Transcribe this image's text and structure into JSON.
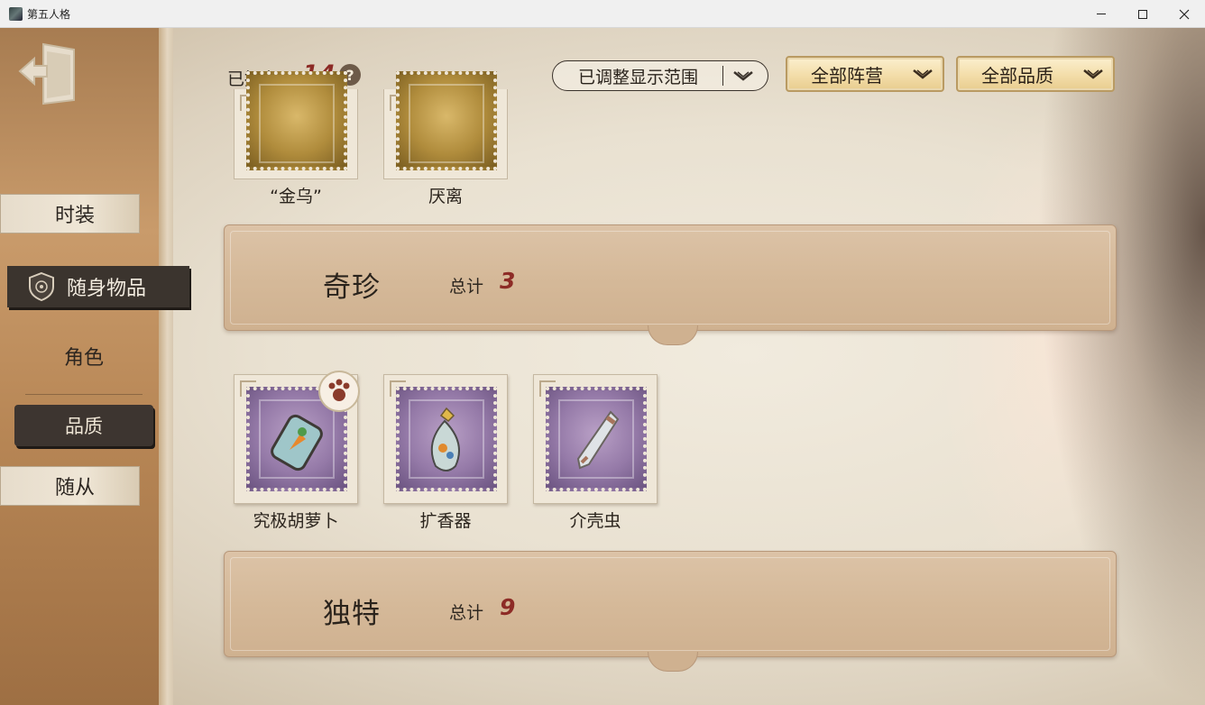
{
  "window": {
    "title": "第五人格"
  },
  "sidebar": {
    "tabs": [
      {
        "label": "时装"
      },
      {
        "label": "随身物品"
      },
      {
        "label": "角色"
      },
      {
        "label": "品质"
      },
      {
        "label": "随从"
      }
    ]
  },
  "header": {
    "owned_label": "已拥有",
    "owned_count": "14",
    "help": "?",
    "scope_filter": "已调整显示范围",
    "faction_filter": "全部阵营",
    "quality_filter": "全部品质"
  },
  "top_items": [
    {
      "name": "“金乌”"
    },
    {
      "name": "厌离"
    }
  ],
  "sections": [
    {
      "title": "奇珍",
      "total_label": "总计",
      "total_value": "3",
      "items": [
        {
          "name": "究极胡萝卜"
        },
        {
          "name": "扩香器"
        },
        {
          "name": "介壳虫"
        }
      ]
    },
    {
      "title": "独特",
      "total_label": "总计",
      "total_value": "9"
    }
  ],
  "colors": {
    "accent_red": "#8c2a25",
    "active_tab": "#3b342e",
    "filter_gold": "#f4dfac",
    "stamp_purple": "#957aa8",
    "stamp_gold": "#b08c3c"
  }
}
